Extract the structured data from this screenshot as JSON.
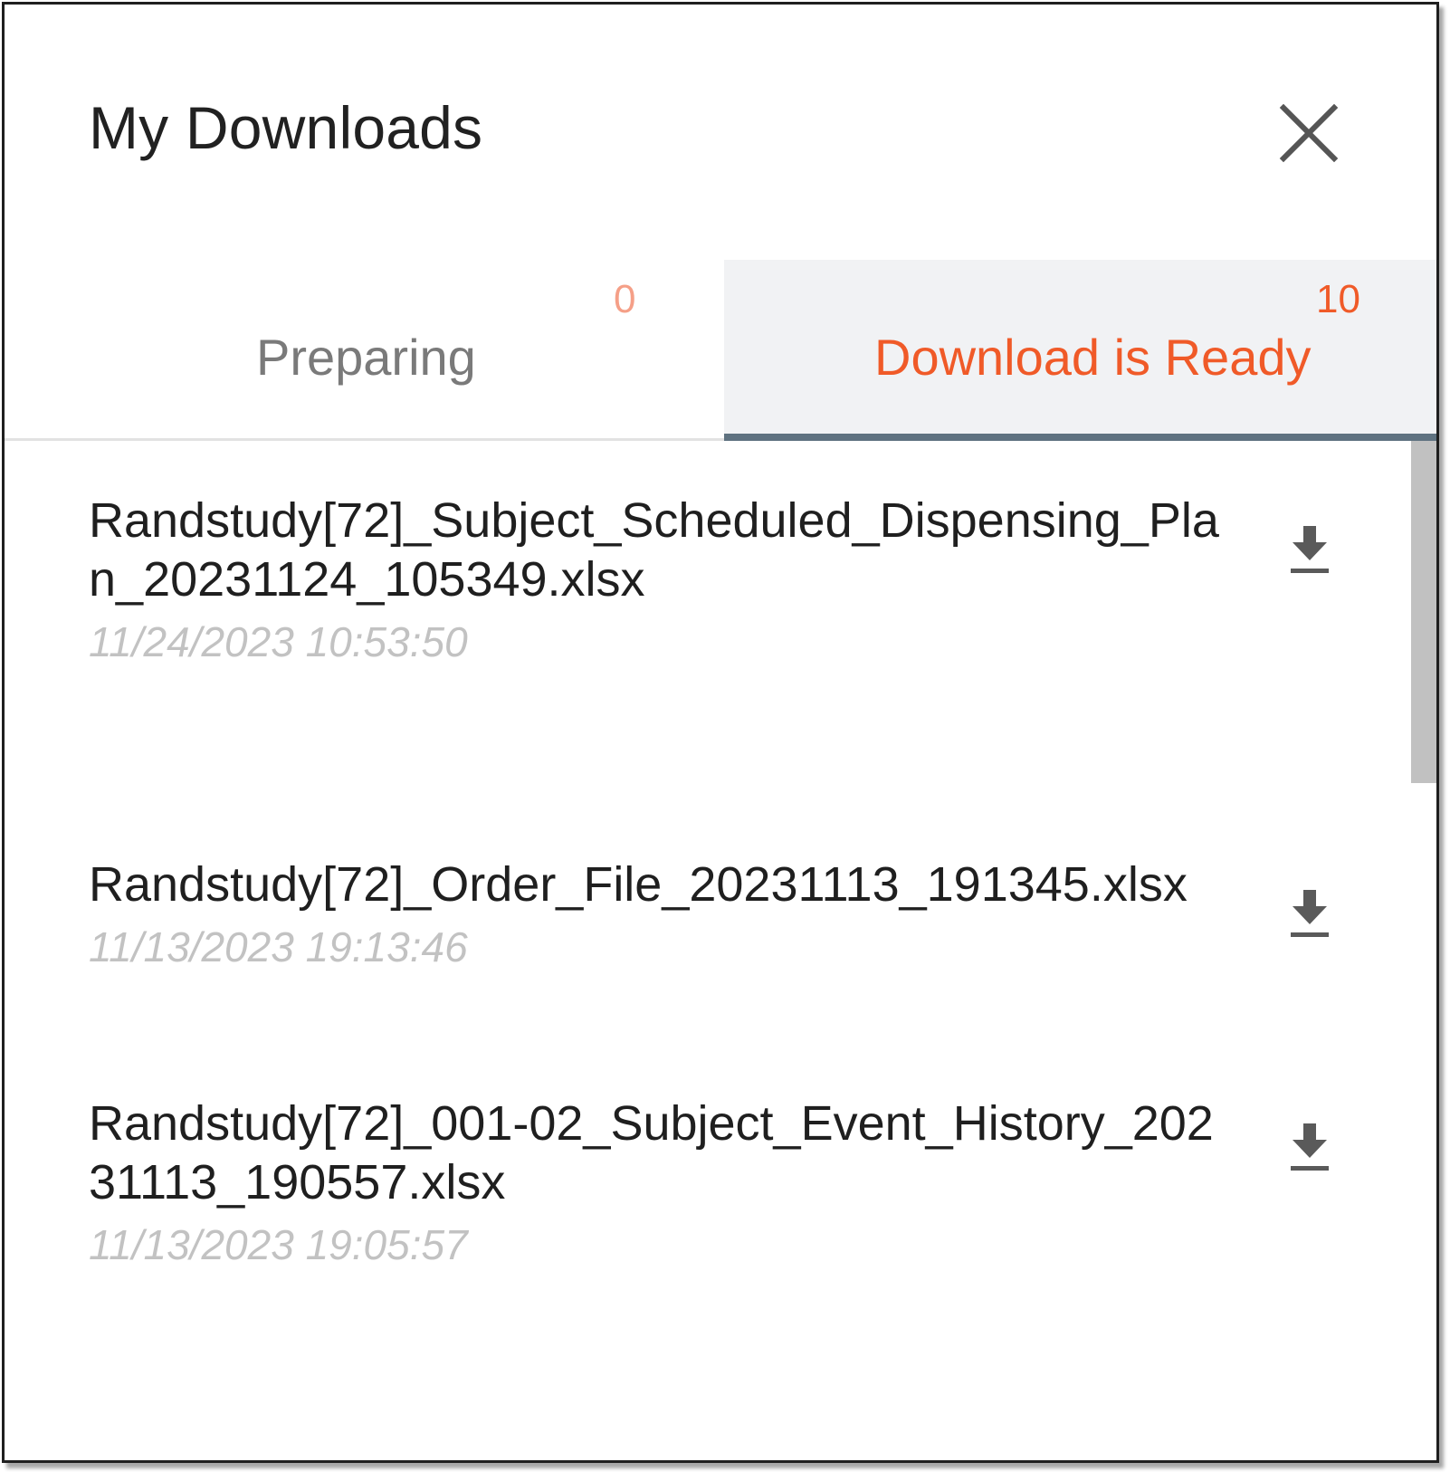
{
  "dialog": {
    "title": "My Downloads",
    "close_icon": "close-icon"
  },
  "tabs": [
    {
      "label": "Preparing",
      "count": "0",
      "active": false
    },
    {
      "label": "Download is Ready",
      "count": "10",
      "active": true
    }
  ],
  "downloads": [
    {
      "name": "Randstudy[72]_Subject_Scheduled_Dispensing_Plan_20231124_105349.xlsx",
      "date": "11/24/2023 10:53:50",
      "icon": "download-icon"
    },
    {
      "name": "Randstudy[72]_Order_File_20231113_191345.xlsx",
      "date": "11/13/2023 19:13:46",
      "icon": "download-icon"
    },
    {
      "name": "Randstudy[72]_001-02_Subject_Event_History_20231113_190557.xlsx",
      "date": "11/13/2023 19:05:57",
      "icon": "download-icon"
    }
  ],
  "colors": {
    "accent": "#f05a28",
    "count_inactive": "#f59f87",
    "tab_active_bg": "#f1f2f4",
    "tab_indicator": "#5f7280",
    "date_text": "#c2c2c2"
  }
}
